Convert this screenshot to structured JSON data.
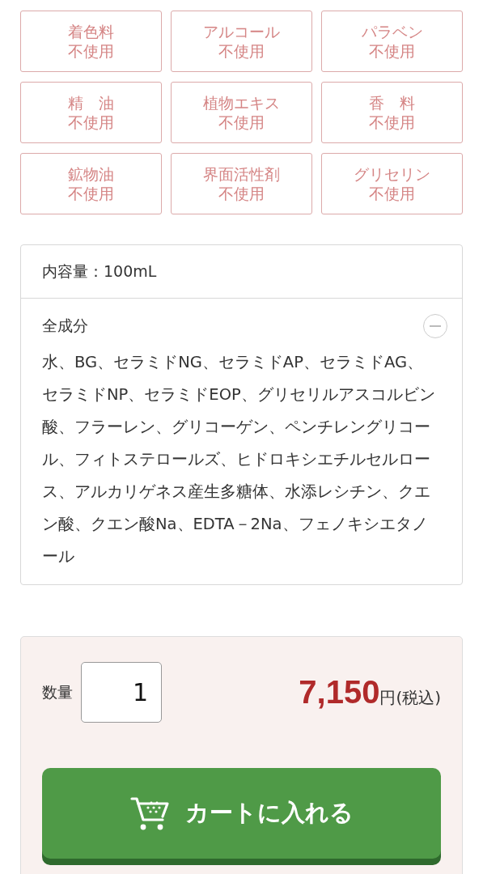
{
  "free_from_badges": [
    {
      "name": "着色料",
      "label": "不使用"
    },
    {
      "name": "アルコール",
      "label": "不使用"
    },
    {
      "name": "パラベン",
      "label": "不使用"
    },
    {
      "name": "精　油",
      "label": "不使用"
    },
    {
      "name": "植物エキス",
      "label": "不使用"
    },
    {
      "name": "香　料",
      "label": "不使用"
    },
    {
      "name": "鉱物油",
      "label": "不使用"
    },
    {
      "name": "界面活性剤",
      "label": "不使用"
    },
    {
      "name": "グリセリン",
      "label": "不使用"
    }
  ],
  "spec": {
    "volume": "内容量：100mL",
    "ingredients": {
      "title": "全成分",
      "expanded": true,
      "text": "水、BG、セラミドNG、セラミドAP、セラミドAG、セラミドNP、セラミドEOP、グリセリルアスコルビン酸、フラーレン、グリコーゲン、ペンチレングリコール、フィトステロールズ、ヒドロキシエチルセルロース、アルカリゲネス産生多糖体、水添レシチン、クエン酸、クエン酸Na、EDTA－2Na、フェノキシエタノール"
    }
  },
  "purchase": {
    "quantity_label": "数量",
    "quantity": "1",
    "price": "7,150",
    "currency": "円",
    "tax_note": "(税込)",
    "cart_button": "カートに入れる"
  }
}
